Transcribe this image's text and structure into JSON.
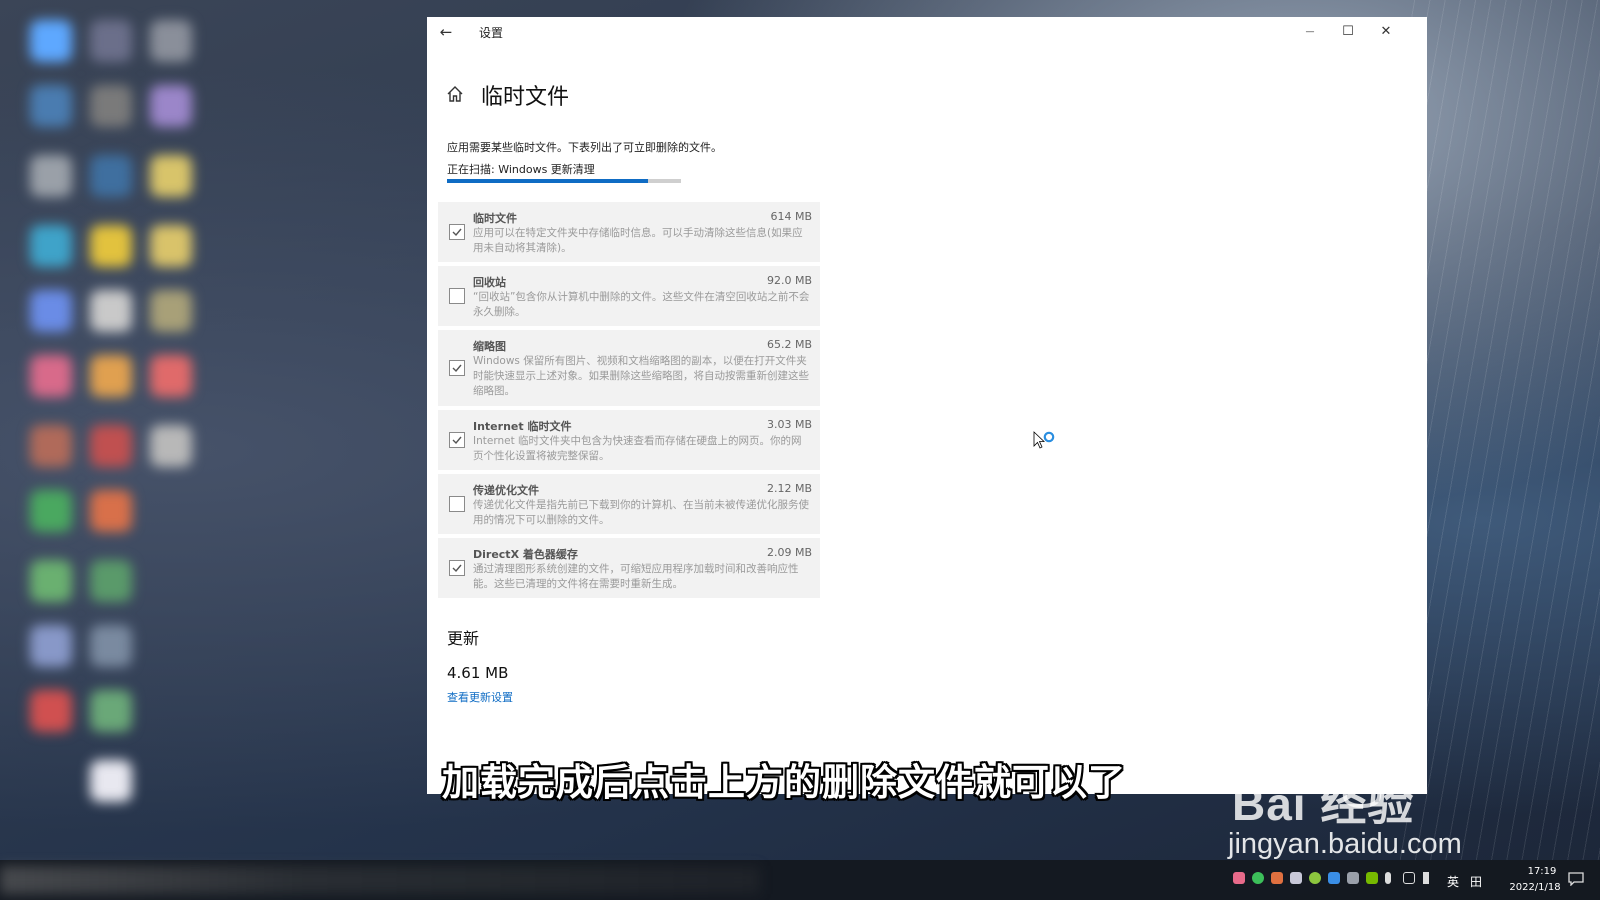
{
  "window": {
    "title": "设置",
    "back_glyph": "←",
    "minimize_glyph": "—",
    "maximize_glyph": "☐",
    "close_glyph": "✕"
  },
  "page": {
    "title": "临时文件",
    "description": "应用需要某些临时文件。下表列出了可立即删除的文件。",
    "scan_status": "正在扫描: Windows 更新清理",
    "scan_progress": 0.86
  },
  "items": [
    {
      "name": "临时文件",
      "size": "614 MB",
      "checked": true,
      "text": "应用可以在特定文件夹中存储临时信息。可以手动清除这些信息(如果应用未自动将其清除)。"
    },
    {
      "name": "回收站",
      "size": "92.0 MB",
      "checked": false,
      "text": "“回收站”包含你从计算机中删除的文件。这些文件在清空回收站之前不会永久删除。"
    },
    {
      "name": "缩略图",
      "size": "65.2 MB",
      "checked": true,
      "text": "Windows 保留所有图片、视频和文档缩略图的副本，以便在打开文件夹时能快速显示上述对象。如果删除这些缩略图，将自动按需重新创建这些缩略图。"
    },
    {
      "name": "Internet 临时文件",
      "size": "3.03 MB",
      "checked": true,
      "text": "Internet 临时文件夹中包含为快速查看而存储在硬盘上的网页。你的网页个性化设置将被完整保留。"
    },
    {
      "name": "传递优化文件",
      "size": "2.12 MB",
      "checked": false,
      "text": "传递优化文件是指先前已下载到你的计算机、在当前未被传递优化服务使用的情况下可以删除的文件。"
    },
    {
      "name": "DirectX 着色器缓存",
      "size": "2.09 MB",
      "checked": true,
      "text": "通过清理图形系统创建的文件，可缩短应用程序加载时间和改善响应性能。这些已清理的文件将在需要时重新生成。"
    }
  ],
  "updates": {
    "heading": "更新",
    "size": "4.61 MB",
    "link": "查看更新设置"
  },
  "caption": "加载完成后点击上方的删除文件就可以了",
  "watermark": {
    "brand": "Bai  经验",
    "url": "jingyan.baidu.com"
  },
  "taskbar": {
    "ime": "英",
    "ime_grid": "田",
    "time": "17:19",
    "date": "2022/1/18"
  },
  "colors": {
    "accent": "#0f6cc4",
    "item_bg": "#f2f2f2"
  }
}
